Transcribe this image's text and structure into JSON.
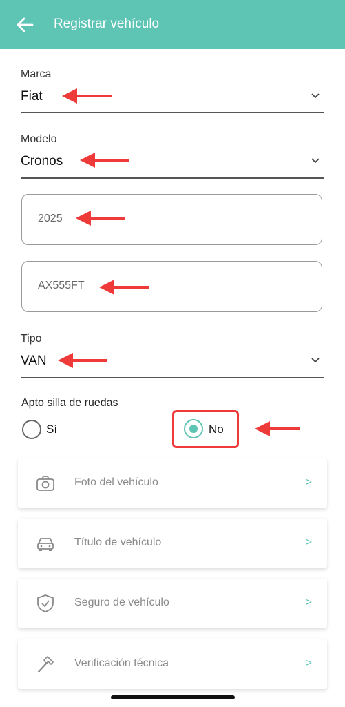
{
  "appbar": {
    "title": "Registrar vehículo"
  },
  "brand": {
    "label": "Marca",
    "value": "Fiat"
  },
  "model": {
    "label": "Modelo",
    "value": "Cronos"
  },
  "year": {
    "value": "2025"
  },
  "plate": {
    "value": "AX555FT"
  },
  "type": {
    "label": "Tipo",
    "value": "VAN"
  },
  "wheelchair": {
    "label": "Apto silla de ruedas",
    "option_yes": "Sí",
    "option_no": "No",
    "selected": "No"
  },
  "cards": [
    {
      "icon": "camera-icon",
      "label": "Foto del vehículo",
      "action": ">"
    },
    {
      "icon": "car-icon",
      "label": "Título de vehículo",
      "action": ">"
    },
    {
      "icon": "shield-check-icon",
      "label": "Seguro de vehículo",
      "action": ">"
    },
    {
      "icon": "hammer-icon",
      "label": "Verificación técnica",
      "action": ">"
    }
  ],
  "colors": {
    "accent": "#5ec4b4",
    "annotation": "#ef3a3a"
  }
}
